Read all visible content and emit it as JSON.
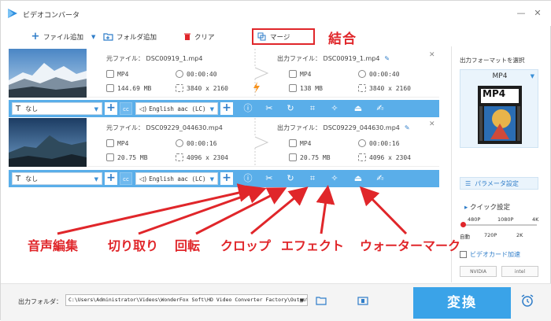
{
  "window": {
    "title": "ビデオコンバータ",
    "min_icon": "minimize-icon",
    "close_icon": "close-icon"
  },
  "toolbar": {
    "add_file": "ファイル追加",
    "add_folder": "フォルダ追加",
    "clear": "クリア",
    "merge": "マージ"
  },
  "annotations": {
    "merge": "結合",
    "audio_edit": "音声編集",
    "cut": "切り取り",
    "rotate": "回転",
    "crop": "クロップ",
    "effect": "エフェクト",
    "watermark": "ウォーターマーク"
  },
  "files": [
    {
      "source_name": "元ファイル： DSC00919_1.mp4",
      "source_format": "MP4",
      "source_duration": "00:00:40",
      "source_size": "144.69 MB",
      "source_resolution": "3840 x 2160",
      "output_name": "出力ファイル： DSC00919_1.mp4",
      "output_format": "MP4",
      "output_duration": "00:00:40",
      "output_size": "138 MB",
      "output_resolution": "3840 x 2160",
      "subtitle": "なし",
      "audio": "English aac (LC)"
    },
    {
      "source_name": "元ファイル： DSC09229_044630.mp4",
      "source_format": "MP4",
      "source_duration": "00:00:16",
      "source_size": "20.75 MB",
      "source_resolution": "4096 x 2304",
      "output_name": "出力ファイル： DSC09229_044630.mp4",
      "output_format": "MP4",
      "output_duration": "00:00:16",
      "output_size": "20.75 MB",
      "output_resolution": "4096 x 2304",
      "subtitle": "なし",
      "audio": "English aac (LC)"
    }
  ],
  "sidebar": {
    "title": "出力フォーマットを選択",
    "format": "MP4",
    "format_tile": "MP4",
    "param_settings": "パラメータ設定",
    "quick_settings": "クイック設定",
    "quality_top": [
      "480P",
      "1080P",
      "4K"
    ],
    "quality_bottom": [
      "自動",
      "720P",
      "2K"
    ],
    "quality_level": 0.0,
    "gpu_accel": "ビデオカード加速",
    "vendor_nvidia": "NVIDIA",
    "vendor_intel": "intel"
  },
  "bottom": {
    "output_folder_label": "出力フォルダ：",
    "output_path": "C:\\Users\\Administrator\\Videos\\WonderFox Soft\\HD Video Converter Factory\\OutputVideo\\",
    "convert": "変換"
  },
  "colors": {
    "accent_blue": "#3aa3e8",
    "bar_blue": "#5aaee9",
    "annotation_red": "#e0262a",
    "bolt_orange": "#f7931e"
  }
}
